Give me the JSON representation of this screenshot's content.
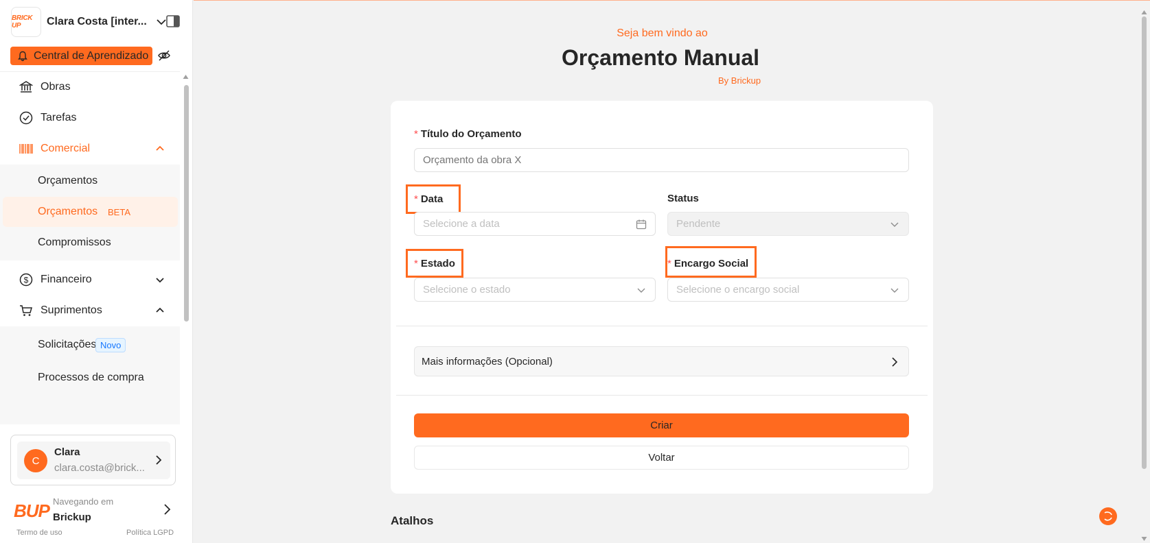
{
  "sidebar": {
    "account_name": "Clara Costa [inter...",
    "logo_text": "BRICK UP",
    "learning_button": "Central de Aprendizado",
    "menu": {
      "obras": "Obras",
      "tarefas": "Tarefas",
      "comercial": "Comercial",
      "comercial_sub": {
        "orcamentos": "Orçamentos",
        "orcamentos_beta": "Orçamentos",
        "beta_badge": "BETA",
        "compromissos": "Compromissos"
      },
      "financeiro": "Financeiro",
      "suprimentos": "Suprimentos",
      "suprimentos_sub": {
        "solicitacoes": "Solicitações",
        "novo_badge": "Novo",
        "processos": "Processos de compra"
      }
    },
    "user": {
      "avatar_letter": "C",
      "name": "Clara",
      "email": "clara.costa@brick..."
    },
    "brand": {
      "logo_text": "BUP",
      "nav_label": "Navegando em",
      "name": "Brickup"
    },
    "footer": {
      "terms": "Termo de uso",
      "privacy": "Política LGPD"
    }
  },
  "header": {
    "welcome": "Seja bem vindo ao",
    "title": "Orçamento Manual",
    "by": "By Brickup"
  },
  "form": {
    "title_label": "Título do Orçamento",
    "title_placeholder": "Orçamento da obra X",
    "date_label": "Data",
    "date_placeholder": "Selecione a data",
    "status_label": "Status",
    "status_value": "Pendente",
    "estado_label": "Estado",
    "estado_placeholder": "Selecione o estado",
    "encargo_label": "Encargo Social",
    "encargo_placeholder": "Selecione o encargo social",
    "more_info": "Mais informações (Opcional)",
    "create_button": "Criar",
    "back_button": "Voltar",
    "required_mark": "*"
  },
  "shortcuts_title": "Atalhos",
  "colors": {
    "accent": "#ff6a1f",
    "required": "#ff4d4f",
    "highlight_border": "#ff6a1f"
  }
}
